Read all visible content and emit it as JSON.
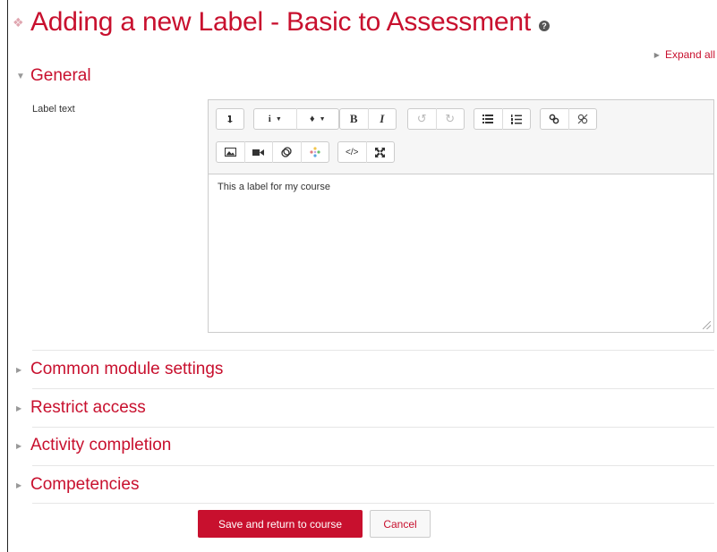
{
  "page": {
    "title": "Adding a new Label - Basic to Assessment"
  },
  "header": {
    "expand_all": "Expand all"
  },
  "sections": {
    "general": "General",
    "common_module_settings": "Common module settings",
    "restrict_access": "Restrict access",
    "activity_completion": "Activity completion",
    "competencies": "Competencies"
  },
  "form": {
    "label_text_label": "Label text",
    "label_text_value": "This a label for my course"
  },
  "toolbar": {
    "row1": [
      "toolbar-toggle",
      "info-dropdown",
      "color-dropdown",
      "bold",
      "italic",
      "undo",
      "redo",
      "unordered-list",
      "ordered-list",
      "link",
      "unlink"
    ],
    "row2": [
      "image",
      "media",
      "manage-files",
      "record-audio",
      "html",
      "fullscreen"
    ],
    "bold_glyph": "B",
    "italic_glyph": "I"
  },
  "actions": {
    "save": "Save and return to course",
    "cancel": "Cancel"
  },
  "colors": {
    "accent": "#c8102e"
  }
}
